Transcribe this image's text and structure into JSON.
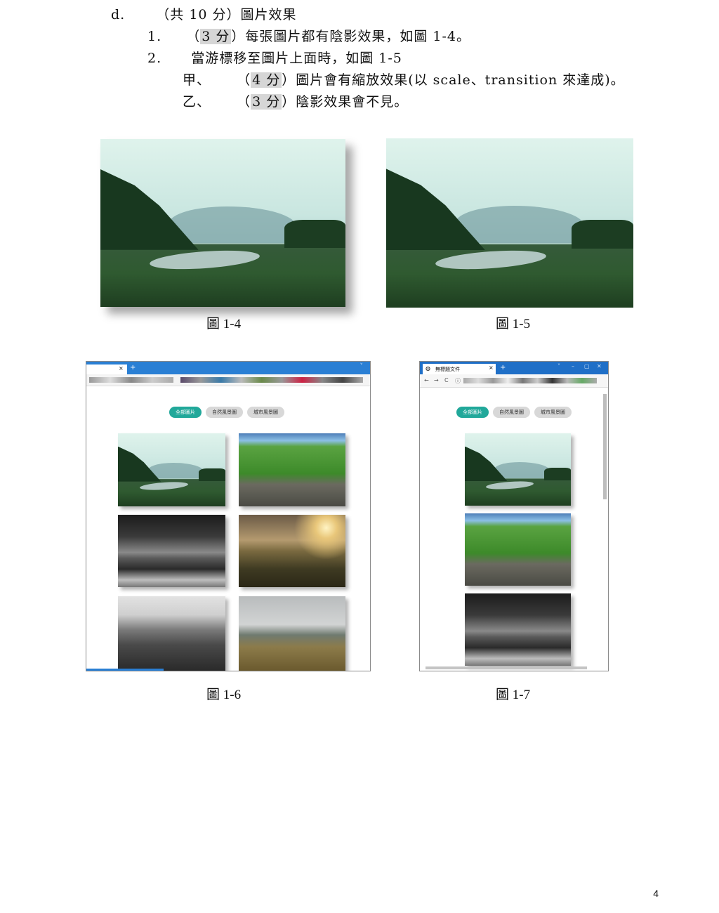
{
  "items": {
    "d": {
      "marker": "d.",
      "text": "（共 10 分）圖片效果"
    },
    "one": {
      "marker": "1.",
      "pre": "（",
      "score": "3 分",
      "post": "）每張圖片都有陰影效果，如圖 1-4。"
    },
    "two": {
      "marker": "2.",
      "text": "當游標移至圖片上面時，如圖 1-5"
    },
    "jia": {
      "marker": "甲、",
      "pre": "（",
      "score": "4 分",
      "post": "）圖片會有縮放效果(以 scale、transition 來達成)。"
    },
    "yi": {
      "marker": "乙、",
      "pre": "（",
      "score": "3 分",
      "post": "）陰影效果會不見。"
    }
  },
  "captions": {
    "fig4": "圖 1-4",
    "fig5": "圖 1-5",
    "fig6": "圖 1-6",
    "fig7": "圖 1-7"
  },
  "fig6": {
    "tab_close": "×",
    "tab_new": "+",
    "chevron": "˅",
    "filters": [
      "全部圖片",
      "自然風景圖",
      "城市風景圖"
    ]
  },
  "fig7": {
    "tab_title": "無標題文件",
    "tab_close": "×",
    "tab_new": "+",
    "window_controls": [
      "˅",
      "–",
      "▢",
      "✕"
    ],
    "nav": [
      "←",
      "→",
      "C",
      "ⓘ"
    ],
    "filters": [
      "全部圖片",
      "自然風景圖",
      "城市風景圖"
    ]
  },
  "page_number": "4"
}
